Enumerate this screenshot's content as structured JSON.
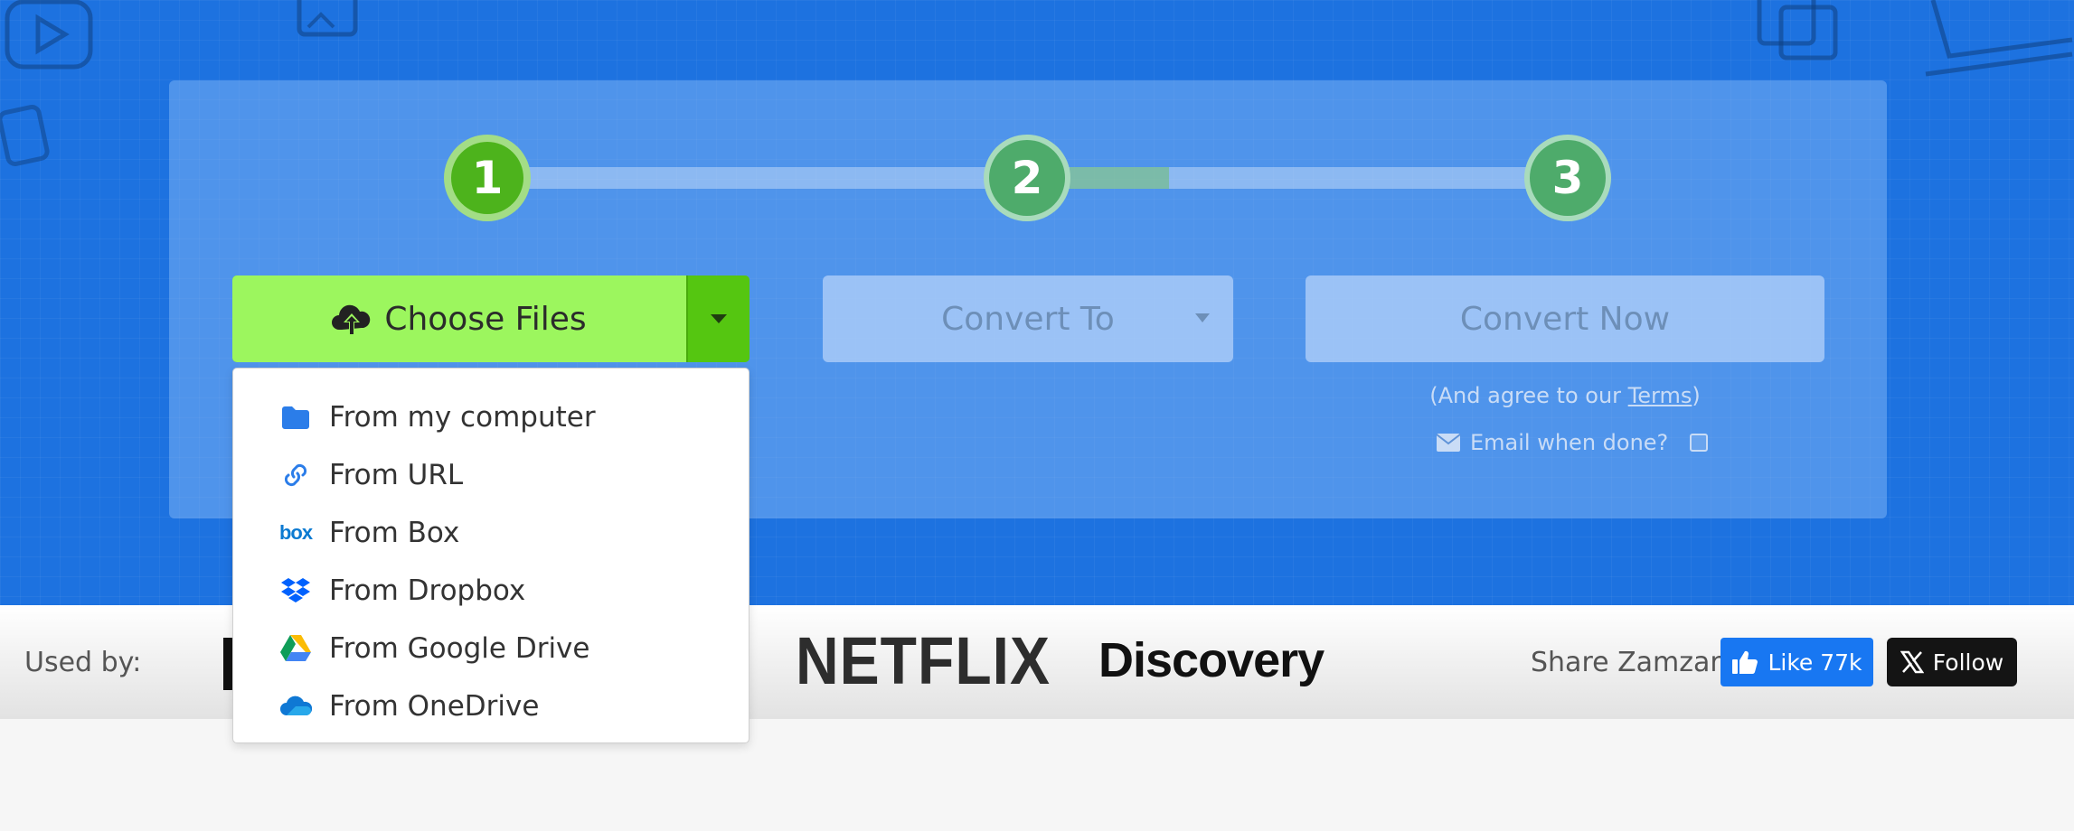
{
  "steps": [
    "1",
    "2",
    "3"
  ],
  "choose_files": {
    "label": "Choose Files",
    "icon": "cloud-upload-icon"
  },
  "convert_to": {
    "label": "Convert To"
  },
  "convert_now": {
    "label": "Convert Now"
  },
  "terms": {
    "prefix": "(And agree to our ",
    "link": "Terms",
    "suffix": ")"
  },
  "email": {
    "label": "Email when done?"
  },
  "source_menu": [
    {
      "label": "From my computer",
      "icon": "folder-icon"
    },
    {
      "label": "From URL",
      "icon": "link-icon"
    },
    {
      "label": "From Box",
      "icon": "box-icon"
    },
    {
      "label": "From Dropbox",
      "icon": "dropbox-icon"
    },
    {
      "label": "From Google Drive",
      "icon": "google-drive-icon"
    },
    {
      "label": "From OneDrive",
      "icon": "onedrive-icon"
    }
  ],
  "box_logo_text": "box",
  "used_by": {
    "label": "Used by:",
    "logos": [
      "NETFLIX",
      "Discovery"
    ]
  },
  "share": {
    "label": "Share Zamzar:",
    "like_label": "Like 77k",
    "follow_label": "Follow"
  },
  "colors": {
    "hero_blue": "#1d72e0",
    "choose_green": "#9cf65e",
    "step_active": "#4db31c",
    "facebook_blue": "#1877f2"
  }
}
